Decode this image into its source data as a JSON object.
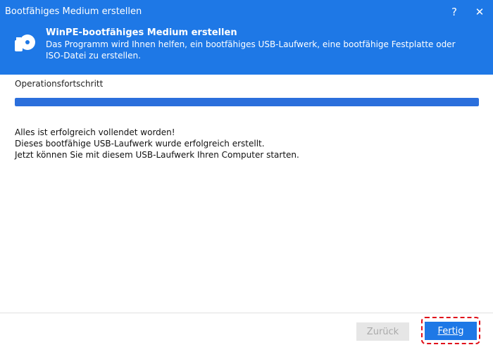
{
  "window": {
    "title": "Bootfähiges Medium erstellen",
    "help_label": "?",
    "close_label": "✕"
  },
  "header": {
    "icon": "usb-disc-icon",
    "title": "WinPE-bootfähiges Medium erstellen",
    "description": "Das Programm wird Ihnen helfen, ein bootfähiges USB-Laufwerk, eine bootfähige Festplatte oder ISO-Datei zu erstellen."
  },
  "progress": {
    "label": "Operationsfortschritt",
    "value": 1.0
  },
  "messages": [
    "Alles ist erfolgreich vollendet worden!",
    "Dieses bootfähige USB-Laufwerk wurde erfolgreich erstellt.",
    "Jetzt können Sie mit diesem USB-Laufwerk Ihren Computer starten."
  ],
  "buttons": {
    "back_label": "Zurück",
    "finish_label": "Fertig"
  },
  "colors": {
    "accent": "#1e78e6",
    "progress_fill": "#2b6fdc",
    "highlight": "#e0101a"
  }
}
